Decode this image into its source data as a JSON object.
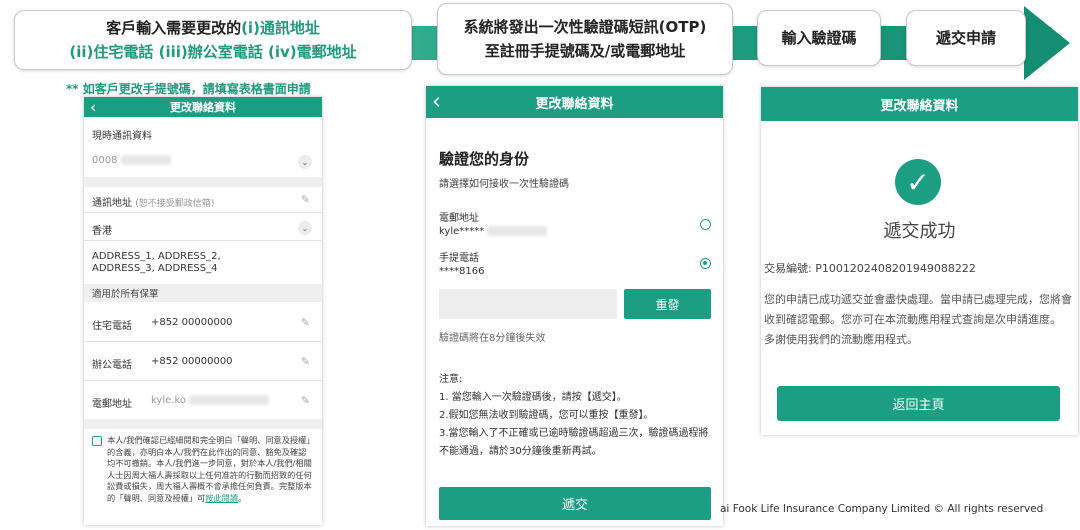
{
  "flow": {
    "step1": {
      "line1_prefix": "客戶輸入需要更改的",
      "line1_highlight": "(i)通訊地址",
      "line2": "(ii)住宅電話 (iii)辦公室電話 (iv)電郵地址"
    },
    "step2": {
      "line1": "系統將發出一次性驗證碼短訊(OTP)",
      "line2": "至註冊手提號碼及/或電郵地址"
    },
    "step3": {
      "label": "輸入驗證碼"
    },
    "step4": {
      "label": "遞交申請"
    },
    "note": "** 如客戶更改手提號碼，請填寫表格書面申請"
  },
  "panel1": {
    "title": "更改聯絡資料",
    "current_contact_label": "現時通訊資料",
    "current_contact_value": "0008",
    "address_label": "通訊地址",
    "address_hint": "(恕不接受郵政信箱)",
    "region_value": "香港",
    "address_value": "ADDRESS_1, ADDRESS_2, ADDRESS_3, ADDRESS_4",
    "section_label": "適用於所有保單",
    "home_phone_label": "住宅電話",
    "home_phone_value": "+852 00000000",
    "office_phone_label": "辦公電話",
    "office_phone_value": "+852 00000000",
    "email_label": "電郵地址",
    "email_value": "kyle.ko",
    "consent_text": "本人/我們確認已經細閱和完全明白「聲明、同意及授權」的含義，亦明白本人/我們在此作出的同意、豁免及確認均不可撤銷。本人/我們進一步同意，對於本人/我們/相關人士因周大福人壽採取以上任何准許的行動而招致的任何訟費或損失，周大福人壽概不會承擔任何負責。完整版本的「聲明、同意及授權」可",
    "consent_link": "按此閱讀",
    "consent_end": "。"
  },
  "panel2": {
    "title": "更改聯絡資料",
    "heading": "驗證您的身份",
    "subheading": "請選擇如何接收一次性驗證碼",
    "email_label": "電郵地址",
    "email_value": "kyle*****",
    "mobile_label": "手提電話",
    "mobile_value": "****8166",
    "otp_placeholder": "",
    "resend_label": "重發",
    "validity_note": "驗證碼將在8分鐘後失效",
    "notes_title": "注意:",
    "note1": "1. 當您輸入一次驗證碼後，請按【遞交】。",
    "note2": "2.假如您無法收到驗證碼，您可以重按【重發】。",
    "note3": "3.當您輸入了不正確或已逾時驗證碼超過三次，驗證碼過程將不能通過，請於30分鐘後重新再試。",
    "submit_label": "遞交"
  },
  "panel3": {
    "title": "更改聯絡資料",
    "success_text": "遞交成功",
    "txn_label": "交易編號:",
    "txn_value": "P100120240820194908822​2",
    "message1": "您的申請已成功遞交並會盡快處理。當申請已處理完成，您將會收到確認電郵。您亦可在本流動應用程式查詢是次申請進度。",
    "message2": "多謝使用我們的流動應用程式。",
    "home_button": "返回主頁"
  },
  "copyright": "ai Fook Life Insurance Company Limited © All rights reserved",
  "colors": {
    "brand_green": "#1c9e82",
    "highlight_green": "#1f9a7c"
  }
}
